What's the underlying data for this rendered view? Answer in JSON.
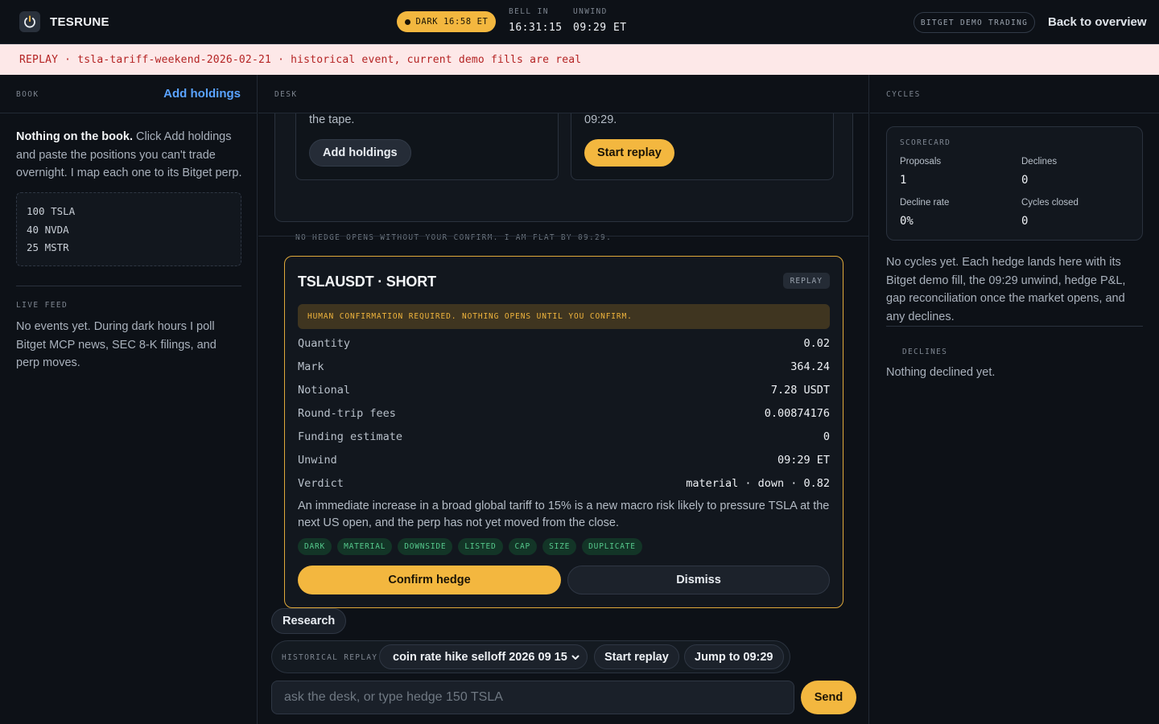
{
  "header": {
    "brand": "TESRUNE",
    "session_pill": "DARK 16:58 ET",
    "bell_label": "BELL IN",
    "bell_value": "16:31:15",
    "unwind_label": "UNWIND",
    "unwind_value": "09:29 ET",
    "mode_badge": "BITGET DEMO TRADING",
    "back_link": "Back to overview"
  },
  "banner": {
    "text": "REPLAY · tsla-tariff-weekend-2026-02-21 · historical event, current demo fills are real"
  },
  "book": {
    "title": "BOOK",
    "add_link": "Add holdings",
    "empty_strong": "Nothing on the book.",
    "empty_text": " Click Add holdings and paste the positions you can't trade overnight. I map each one to its Bitget perp.",
    "example_lines": [
      "100 TSLA",
      "40 NVDA",
      "25 MSTR"
    ],
    "feed_title": "LIVE FEED",
    "feed_text": "No events yet. During dark hours I poll Bitget MCP news, SEC 8-K filings, and perp moves."
  },
  "desk": {
    "title": "DESK",
    "card1_text": "the tape.",
    "card1_button": "Add holdings",
    "card2_text": "09:29.",
    "card2_button": "Start replay",
    "footer_note": "NO HEDGE OPENS WITHOUT YOUR CONFIRM. I AM FLAT BY 09:29.",
    "proposal": {
      "title": "TSLAUSDT · SHORT",
      "badge": "REPLAY",
      "confirm_notice": "HUMAN CONFIRMATION REQUIRED. NOTHING OPENS UNTIL YOU CONFIRM.",
      "rows": [
        {
          "label": "Quantity",
          "value": "0.02"
        },
        {
          "label": "Mark",
          "value": "364.24"
        },
        {
          "label": "Notional",
          "value": "7.28 USDT"
        },
        {
          "label": "Round-trip fees",
          "value": "0.00874176"
        },
        {
          "label": "Funding estimate",
          "value": "0"
        },
        {
          "label": "Unwind",
          "value": "09:29 ET"
        },
        {
          "label": "Verdict",
          "value": "material · down · 0.82"
        }
      ],
      "rationale": "An immediate increase in a broad global tariff to 15% is a new macro risk likely to pressure TSLA at the next US open, and the perp has not yet moved from the close.",
      "tags": [
        "DARK",
        "MATERIAL",
        "DOWNSIDE",
        "LISTED",
        "CAP",
        "SIZE",
        "DUPLICATE"
      ],
      "confirm_button": "Confirm hedge",
      "dismiss_button": "Dismiss"
    },
    "research_button": "Research",
    "replay": {
      "label": "HISTORICAL REPLAY",
      "selected": "coin rate hike selloff 2026 09 15",
      "start_button": "Start replay",
      "jump_button": "Jump to 09:29"
    },
    "input_placeholder": "ask the desk, or type hedge 150 TSLA",
    "send_button": "Send"
  },
  "cycles": {
    "title": "CYCLES",
    "scorecard_title": "SCORECARD",
    "stats": [
      {
        "label": "Proposals",
        "value": "1"
      },
      {
        "label": "Declines",
        "value": "0"
      },
      {
        "label": "Decline rate",
        "value": "0%"
      },
      {
        "label": "Cycles closed",
        "value": "0"
      }
    ],
    "empty_text": "No cycles yet. Each hedge lands here with its Bitget demo fill, the 09:29 unwind, hedge P&L, gap reconciliation once the market opens, and any declines.",
    "declines_title": "DECLINES",
    "declines_text": "Nothing declined yet."
  },
  "colors": {
    "accent": "#f3b73f",
    "link": "#5aa3ff",
    "banner_bg": "#fde8e8",
    "banner_text": "#b42323",
    "tag_text": "#55c98c"
  },
  "icons": [
    "power-icon",
    "chevron-down-icon"
  ]
}
